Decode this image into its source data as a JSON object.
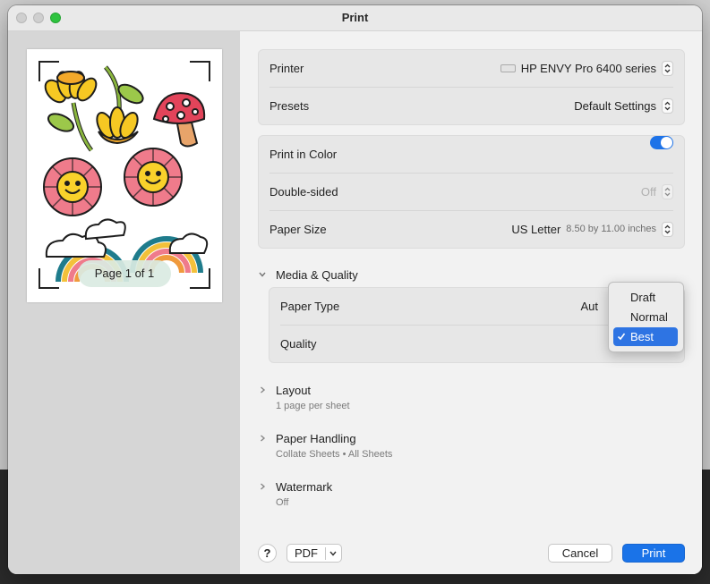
{
  "window": {
    "title": "Print"
  },
  "preview": {
    "page_label": "Page 1 of 1"
  },
  "printer": {
    "label": "Printer",
    "value": "HP ENVY Pro 6400 series",
    "icon": "printer-icon"
  },
  "presets": {
    "label": "Presets",
    "value": "Default Settings"
  },
  "print_in_color": {
    "label": "Print in Color",
    "on": true
  },
  "double_sided": {
    "label": "Double-sided",
    "value": "Off"
  },
  "paper_size": {
    "label": "Paper Size",
    "value": "US Letter",
    "detail": "8.50 by 11.00 inches"
  },
  "media_quality": {
    "title": "Media & Quality",
    "paper_type_label": "Paper Type",
    "paper_type_value": "Aut",
    "quality_label": "Quality",
    "quality_options": [
      "Draft",
      "Normal",
      "Best"
    ],
    "quality_selected": "Best"
  },
  "layout": {
    "title": "Layout",
    "summary": "1 page per sheet"
  },
  "paper_handling": {
    "title": "Paper Handling",
    "summary": "Collate Sheets • All Sheets"
  },
  "watermark": {
    "title": "Watermark",
    "summary": "Off"
  },
  "buttons": {
    "help": "?",
    "pdf": "PDF",
    "cancel": "Cancel",
    "print": "Print"
  },
  "colors": {
    "accent": "#1a73e8",
    "toggle_on": "#1e73e8",
    "zoom_button": "#2ec33f"
  }
}
